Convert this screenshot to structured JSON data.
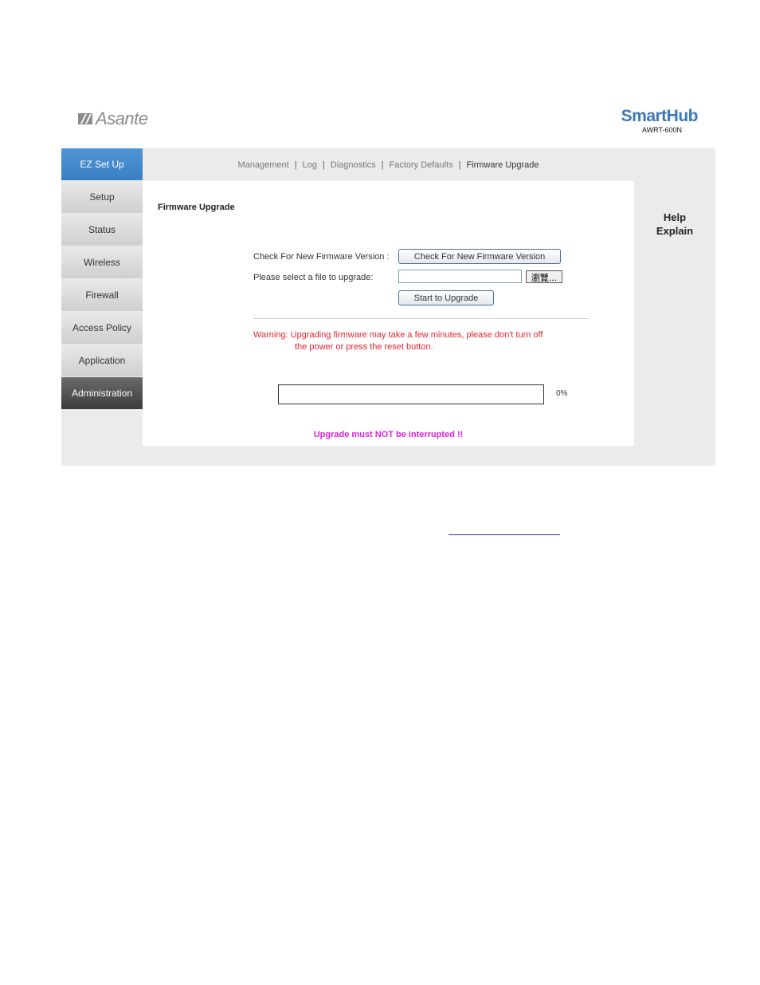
{
  "branding": {
    "left_logo": "Asante",
    "right_brand": "SmartHub",
    "right_model": "AWRT-600N",
    "brand_blue": "#3c79b8"
  },
  "sidebar": {
    "items": [
      {
        "label": "EZ Set Up",
        "state": "active"
      },
      {
        "label": "Setup",
        "state": "normal"
      },
      {
        "label": "Status",
        "state": "normal"
      },
      {
        "label": "Wireless",
        "state": "normal"
      },
      {
        "label": "Firewall",
        "state": "normal"
      },
      {
        "label": "Access Policy",
        "state": "normal"
      },
      {
        "label": "Application",
        "state": "normal"
      },
      {
        "label": "Administration",
        "state": "selected-dark"
      }
    ]
  },
  "subnav": {
    "items": [
      "Management",
      "Log",
      "Diagnostics",
      "Factory Defaults",
      "Firmware Upgrade"
    ],
    "separator": "|",
    "current": "Firmware Upgrade"
  },
  "main": {
    "title": "Firmware Upgrade",
    "check_label": "Check For New Firmware Version :",
    "check_button": "Check For New Firmware Version",
    "select_label": "Please select a file to upgrade:",
    "file_value": "",
    "browse_button": "瀏覽...",
    "start_button": "Start to Upgrade",
    "warning_label": "Warning:",
    "warning_line1": "Upgrading firmware may take a few minutes, please don't turn off",
    "warning_line2": "the power or press the reset button.",
    "progress_percent": 0,
    "progress_text": "0%",
    "notice": "Upgrade must NOT be interrupted !!",
    "warning_color": "#e0242f",
    "notice_color": "#d81fd8"
  },
  "help": {
    "line1": "Help",
    "line2": "Explain"
  }
}
